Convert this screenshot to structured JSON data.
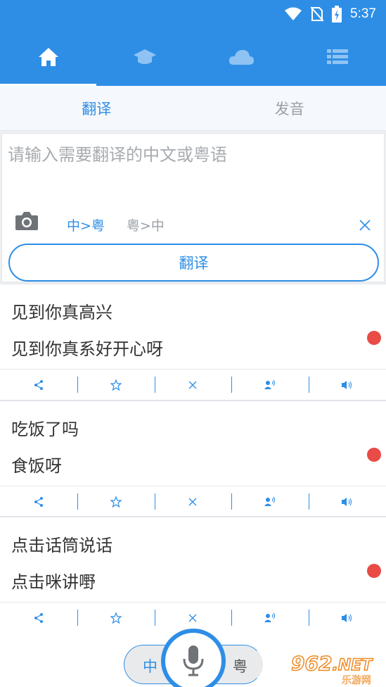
{
  "status_bar": {
    "time": "5:37",
    "icons": [
      "wifi-icon",
      "no-sim-icon",
      "battery-charging-icon"
    ]
  },
  "top_nav": {
    "items": [
      {
        "icon": "home-icon",
        "active": true
      },
      {
        "icon": "graduation-cap-icon",
        "active": false
      },
      {
        "icon": "cloud-icon",
        "active": false
      },
      {
        "icon": "list-icon",
        "active": false
      }
    ]
  },
  "sub_tabs": {
    "translate": "翻译",
    "pronounce": "发音"
  },
  "input": {
    "placeholder": "请输入需要翻译的中文或粤语",
    "dir_zh_to_yue": "中>粤",
    "dir_yue_to_zh": "粤>中",
    "translate_button": "翻译"
  },
  "results": [
    {
      "source": "见到你真高兴",
      "target": "见到你真系好开心呀"
    },
    {
      "source": "吃饭了吗",
      "target": "食饭呀"
    },
    {
      "source": "点击话筒说话",
      "target": "点击咪讲嘢"
    }
  ],
  "result_actions": [
    "share-icon",
    "star-icon",
    "close-icon",
    "speaker-person-icon",
    "volume-icon"
  ],
  "bottom": {
    "lang_left": "中",
    "lang_right": "粤"
  },
  "watermark": {
    "number": "962",
    "suffix": ".NET",
    "site": "乐游网"
  },
  "colors": {
    "primary": "#2e8ee6",
    "dot": "#e94b46",
    "watermark": "#f08a24"
  }
}
